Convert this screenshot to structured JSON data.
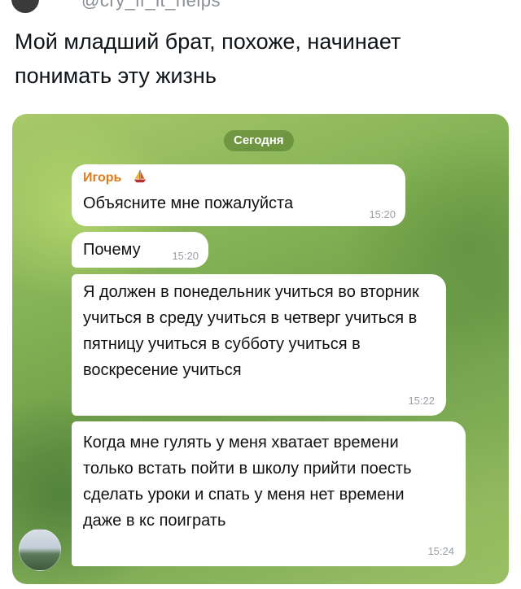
{
  "tweet": {
    "handle": "@cry_if_it_helps",
    "text": "Мой младший брат, похоже, начинает понимать эту жизнь"
  },
  "chat": {
    "date_label": "Сегодня",
    "messages": [
      {
        "sender": "Игорь",
        "sender_icon": "sailboat-emoji",
        "text": "Объясните мне пожалуйста",
        "time": "15:20"
      },
      {
        "text": "Почему",
        "time": "15:20"
      },
      {
        "text": "Я должен в понедельник учиться во вторник учиться в среду учиться в четверг учиться в пятницу учиться в субботу учиться в воскресение учиться",
        "time": "15:22"
      },
      {
        "text": "Когда мне гулять у меня хватает времени только встать пойти в школу прийти поесть сделать уроки и спать у меня нет времени даже в кс поиграть",
        "time": "15:24"
      }
    ],
    "colors": {
      "sender_name": "#e07b1a",
      "bubble": "#ffffff",
      "time": "#9aa0a6",
      "background": "#86b356"
    }
  }
}
